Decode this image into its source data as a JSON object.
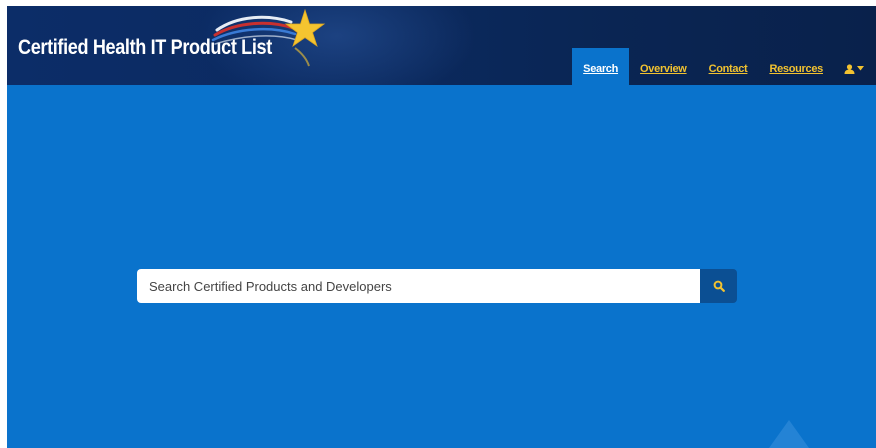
{
  "header": {
    "title": "Certified Health IT Product List"
  },
  "nav": {
    "items": [
      {
        "label": "Search",
        "active": true
      },
      {
        "label": "Overview",
        "active": false
      },
      {
        "label": "Contact",
        "active": false
      },
      {
        "label": "Resources",
        "active": false
      }
    ],
    "user_icon": "user-icon",
    "user_caret_icon": "caret-down-icon"
  },
  "search": {
    "placeholder": "Search Certified Products and Developers",
    "value": "",
    "button_icon": "search-icon"
  },
  "colors": {
    "page_background": "#0a73cc",
    "header_background": "#0c2d68",
    "nav_link": "#f2c230",
    "search_button": "#0b4f93"
  }
}
